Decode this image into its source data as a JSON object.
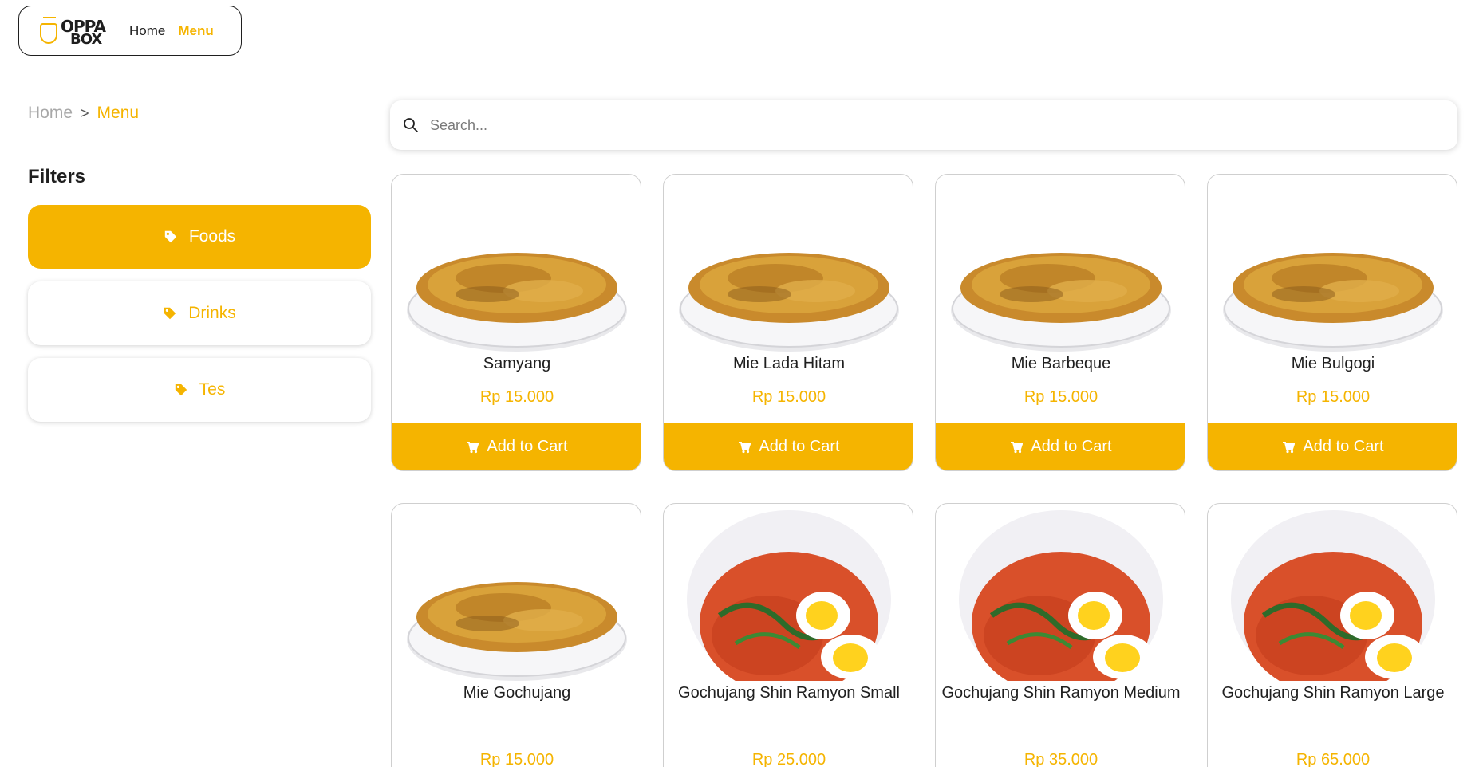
{
  "brand": {
    "logo_line1": "OPPA",
    "logo_line2": "BOX"
  },
  "nav": {
    "home": "Home",
    "menu": "Menu"
  },
  "breadcrumb": {
    "home": "Home",
    "separator": ">",
    "current": "Menu"
  },
  "filters": {
    "title": "Filters",
    "items": [
      {
        "label": "Foods",
        "active": true
      },
      {
        "label": "Drinks",
        "active": false
      },
      {
        "label": "Tes",
        "active": false
      }
    ]
  },
  "search": {
    "placeholder": "Search..."
  },
  "colors": {
    "accent": "#f5b400",
    "text": "#1f1f1f",
    "muted": "#a8a8a8"
  },
  "cart_label": "Add to Cart",
  "products": [
    {
      "name": "Samyang",
      "price": "Rp 15.000",
      "image": "fried-noodle-bowl"
    },
    {
      "name": "Mie Lada Hitam",
      "price": "Rp 15.000",
      "image": "fried-noodle-bowl"
    },
    {
      "name": "Mie Barbeque",
      "price": "Rp 15.000",
      "image": "fried-noodle-bowl"
    },
    {
      "name": "Mie Bulgogi",
      "price": "Rp 15.000",
      "image": "fried-noodle-bowl"
    },
    {
      "name": "Mie Gochujang",
      "price": "Rp 15.000",
      "image": "fried-noodle-bowl"
    },
    {
      "name": "Gochujang Shin Ramyon Small",
      "price": "Rp 25.000",
      "image": "ramen-egg-bowl"
    },
    {
      "name": "Gochujang Shin Ramyon Medium",
      "price": "Rp 35.000",
      "image": "ramen-egg-bowl"
    },
    {
      "name": "Gochujang Shin Ramyon Large",
      "price": "Rp 65.000",
      "image": "ramen-egg-bowl"
    }
  ]
}
